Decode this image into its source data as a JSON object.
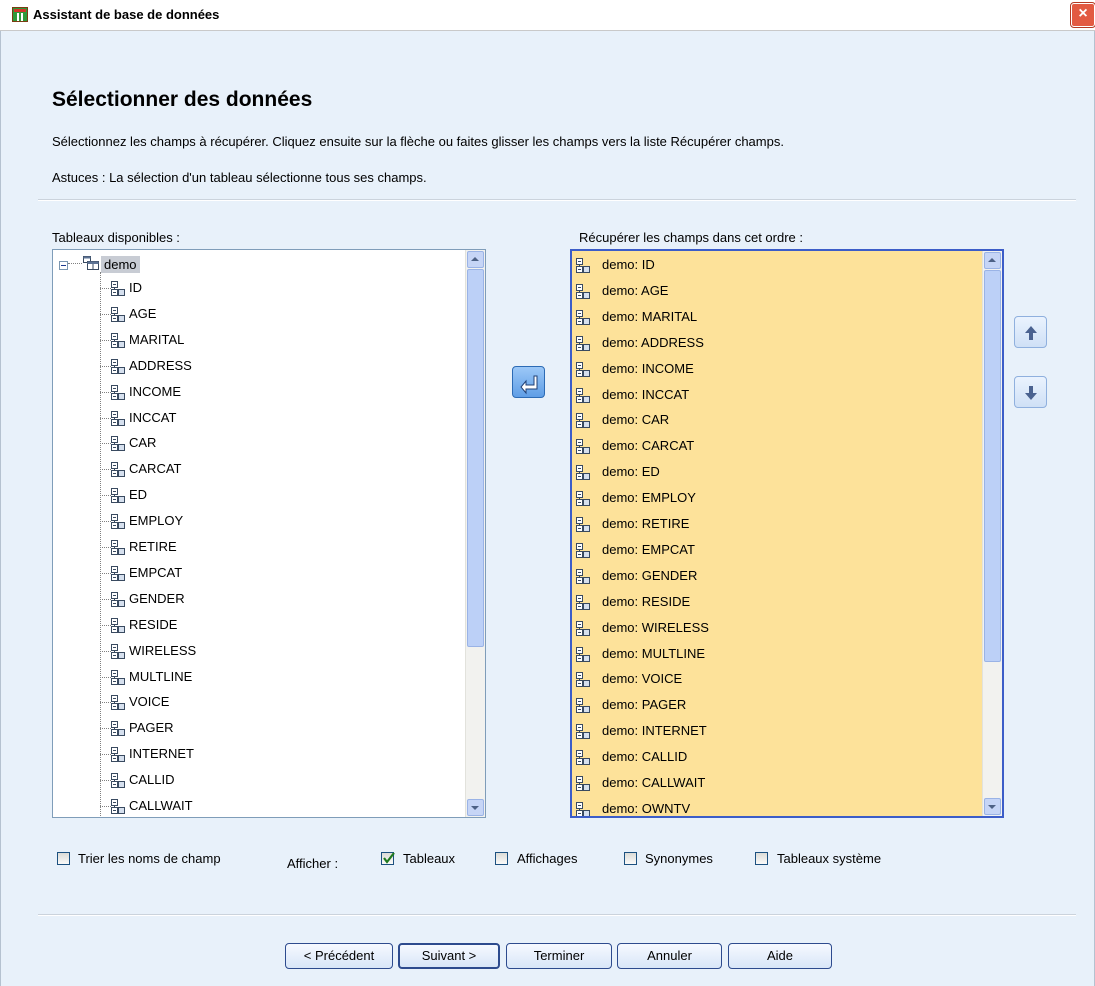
{
  "window": {
    "title": "Assistant de base de données",
    "close_glyph": "×"
  },
  "page": {
    "title": "Sélectionner des données",
    "instruction": "Sélectionnez les champs à récupérer. Cliquez ensuite sur la flèche ou faites glisser les champs vers la liste Récupérer champs.",
    "tip": "Astuces : La sélection d'un tableau sélectionne tous ses champs."
  },
  "available": {
    "label": "Tableaux disponibles :",
    "table": "demo",
    "fields": [
      "ID",
      "AGE",
      "MARITAL",
      "ADDRESS",
      "INCOME",
      "INCCAT",
      "CAR",
      "CARCAT",
      "ED",
      "EMPLOY",
      "RETIRE",
      "EMPCAT",
      "GENDER",
      "RESIDE",
      "WIRELESS",
      "MULTLINE",
      "VOICE",
      "PAGER",
      "INTERNET",
      "CALLID",
      "CALLWAIT"
    ]
  },
  "selected": {
    "label": "Récupérer les champs dans cet ordre :",
    "fields": [
      "demo: ID",
      "demo: AGE",
      "demo: MARITAL",
      "demo: ADDRESS",
      "demo: INCOME",
      "demo: INCCAT",
      "demo: CAR",
      "demo: CARCAT",
      "demo: ED",
      "demo: EMPLOY",
      "demo: RETIRE",
      "demo: EMPCAT",
      "demo: GENDER",
      "demo: RESIDE",
      "demo: WIRELESS",
      "demo: MULTLINE",
      "demo: VOICE",
      "demo: PAGER",
      "demo: INTERNET",
      "demo: CALLID",
      "demo: CALLWAIT",
      "demo: OWNTV"
    ]
  },
  "options": {
    "sort_label": "Trier les noms de champ",
    "show_label": "Afficher :",
    "sort_checked": false,
    "checkboxes": [
      {
        "label": "Tableaux",
        "checked": true
      },
      {
        "label": "Affichages",
        "checked": false
      },
      {
        "label": "Synonymes",
        "checked": false
      },
      {
        "label": "Tableaux système",
        "checked": false
      }
    ]
  },
  "buttons": {
    "previous": "< Précédent",
    "next": "Suivant >",
    "finish": "Terminer",
    "cancel": "Annuler",
    "help": "Aide"
  },
  "colors": {
    "background": "#e8f1fa",
    "selected_list_bg": "#fde29a",
    "selected_list_border": "#3c5dc8",
    "primary_arrow": "#5f9ee6"
  },
  "icons": {
    "app": "table-grid-icon",
    "close": "close-icon",
    "field": "field-icon",
    "table": "table-icon",
    "add": "arrow-left-icon",
    "up": "arrow-up-icon",
    "down": "arrow-down-icon"
  }
}
